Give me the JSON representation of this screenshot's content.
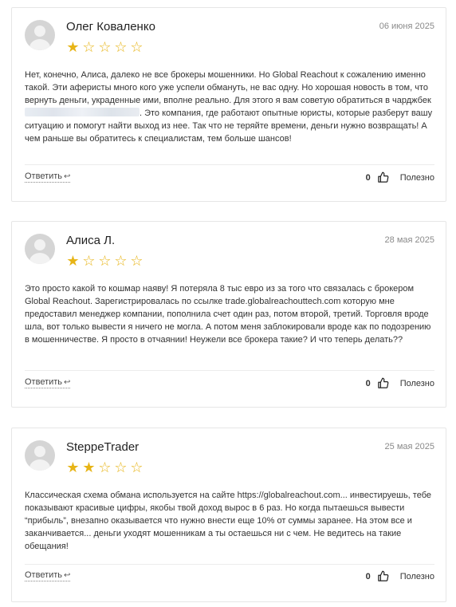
{
  "reviews": [
    {
      "author": "Олег Коваленко",
      "date": "06 июня 2025",
      "rating": 1,
      "text_before": "Нет, конечно, Алиса, далеко не все брокеры мошенники. Но Global Reachout к сожалению именно такой. Эти аферисты много кого уже успели обмануть, не вас одну. Но хорошая новость в том, что вернуть деньги, украденные ими, вполне реально. Для этого я вам советую обратиться в чарджбек ",
      "text_after": ". Это компания, где работают опытные юристы, которые разберут вашу ситуацию и помогут найти выход из нее. Так что не теряйте времени, деньги нужно возвращать! А чем раньше вы обратитесь к специалистам, тем больше шансов!",
      "reply_label": "Ответить",
      "likes": "0",
      "useful_label": "Полезно"
    },
    {
      "author": "Алиса Л.",
      "date": "28 мая 2025",
      "rating": 1,
      "text": "Это просто какой то кошмар наяву! Я потеряла 8 тыс евро из за того что связалась с брокером Global Reachout. Зарегистрировалась по ссылке trade.globalreachouttech.com которую мне предоставил менеджер компании, пополнила счет один раз, потом второй, третий. Торговля вроде шла, вот только вывести я ничего не могла. А потом меня заблокировали вроде как по подозрению в мошенничестве. Я просто в отчаянии! Неужели все брокера такие? И что теперь делать??",
      "reply_label": "Ответить",
      "likes": "0",
      "useful_label": "Полезно"
    },
    {
      "author": "SteppeTrader",
      "date": "25 мая 2025",
      "rating": 2,
      "text": "Классическая схема обмана используется на сайте https://globalreachout.com... инвестируешь, тебе показывают красивые цифры, якобы твой доход вырос в 6 раз. Но когда пытаешься вывести “прибыль”, внезапно оказывается что нужно внести еще 10% от суммы заранее. На этом все и заканчивается... деньги уходят мошенникам а ты остаешься ни с чем. Не ведитесь на такие обещания!",
      "reply_label": "Ответить",
      "likes": "0",
      "useful_label": "Полезно"
    }
  ],
  "icons": {
    "star_full": "star-filled-icon",
    "star_empty": "star-outline-icon",
    "reply": "reply-arrow-icon",
    "like": "thumbs-up-icon"
  },
  "colors": {
    "star": "#e7b416",
    "border": "#e6e6e6",
    "date": "#8a8a8a"
  }
}
